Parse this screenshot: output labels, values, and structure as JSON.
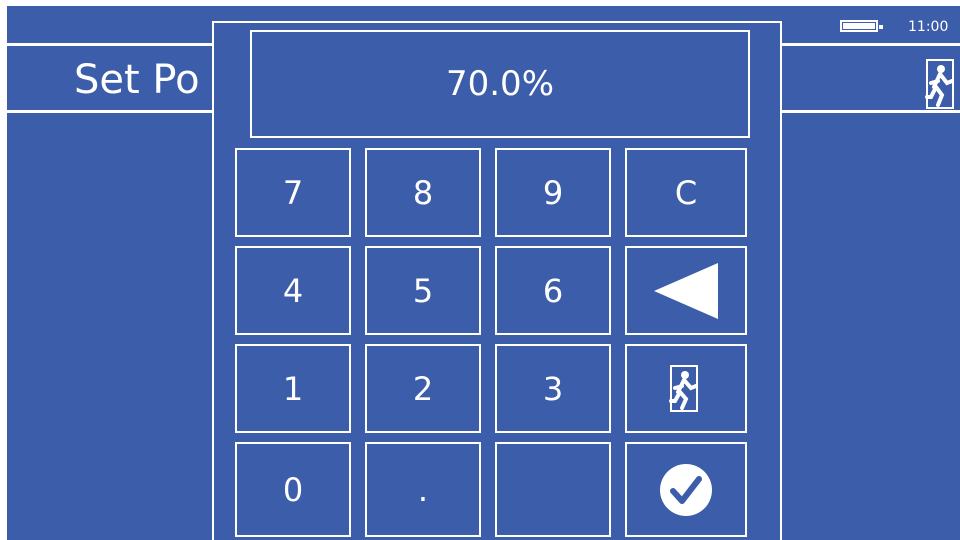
{
  "status_bar": {
    "time": "11:00",
    "battery_icon": "battery-icon"
  },
  "header": {
    "title": "Set Po",
    "exit_icon": "exit-running-man-icon"
  },
  "keypad": {
    "display_value": "70.0%",
    "keys": {
      "seven": "7",
      "eight": "8",
      "nine": "9",
      "clear": "C",
      "four": "4",
      "five": "5",
      "six": "6",
      "backspace_icon": "backspace-triangle-icon",
      "one": "1",
      "two": "2",
      "three": "3",
      "exit_icon": "exit-running-man-icon",
      "zero": "0",
      "decimal": ".",
      "blank": "",
      "confirm_icon": "checkmark-circle-icon"
    }
  },
  "colors": {
    "background": "#3c5daa",
    "foreground": "#ffffff"
  }
}
